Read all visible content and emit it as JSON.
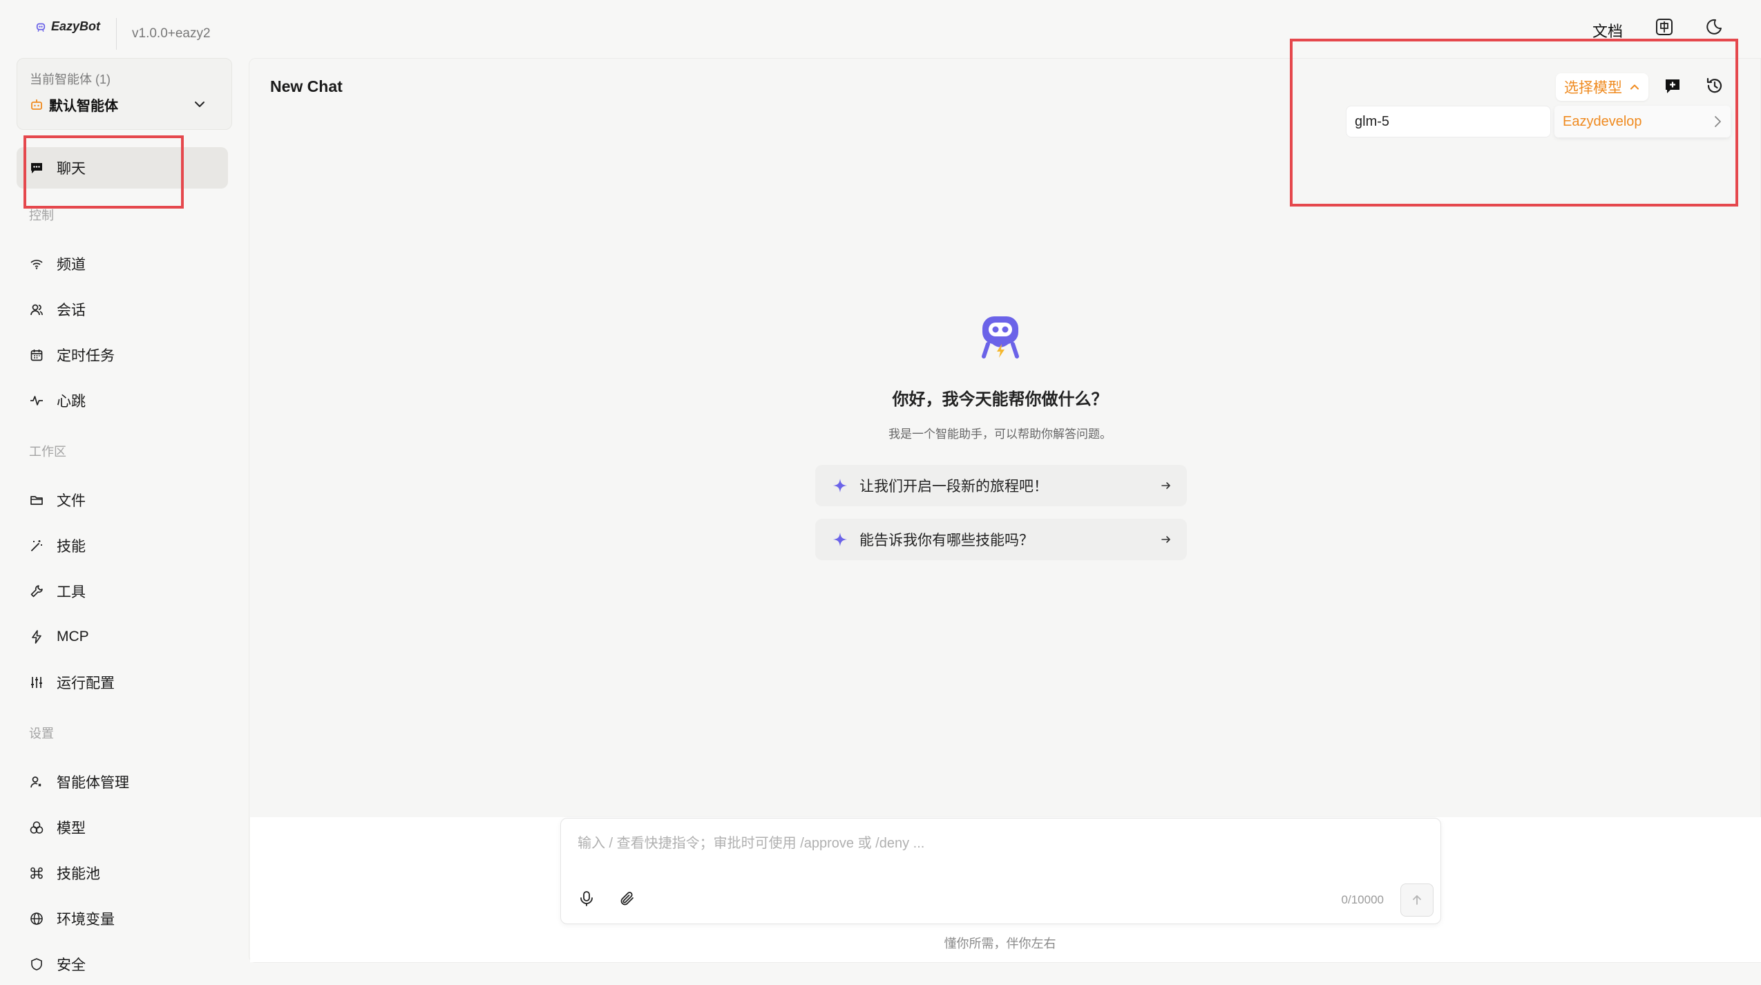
{
  "app": {
    "name": "EazyBot",
    "version": "v1.0.0+eazy2"
  },
  "topbar": {
    "docs_label": "文档",
    "lang_icon": "language-icon",
    "theme_icon": "moon-icon"
  },
  "agent_selector": {
    "caption": "当前智能体 (1)",
    "name": "默认智能体",
    "icon": "bot-icon"
  },
  "sidebar": {
    "chat_label": "聊天",
    "sections": {
      "control": "控制",
      "workspace": "工作区",
      "settings": "设置"
    },
    "control_items": [
      {
        "label": "频道",
        "icon": "wifi-icon"
      },
      {
        "label": "会话",
        "icon": "users-icon"
      },
      {
        "label": "定时任务",
        "icon": "calendar-icon"
      },
      {
        "label": "心跳",
        "icon": "pulse-icon"
      }
    ],
    "workspace_items": [
      {
        "label": "文件",
        "icon": "folder-icon"
      },
      {
        "label": "技能",
        "icon": "magic-wand-icon"
      },
      {
        "label": "工具",
        "icon": "wrench-icon"
      },
      {
        "label": "MCP",
        "icon": "lightning-icon"
      },
      {
        "label": "运行配置",
        "icon": "sliders-icon"
      }
    ],
    "settings_items": [
      {
        "label": "智能体管理",
        "icon": "user-cog-icon"
      },
      {
        "label": "模型",
        "icon": "model-icon"
      },
      {
        "label": "技能池",
        "icon": "command-icon"
      },
      {
        "label": "环境变量",
        "icon": "globe-icon"
      },
      {
        "label": "安全",
        "icon": "shield-icon"
      }
    ]
  },
  "chat": {
    "title": "New Chat",
    "model_select_label": "选择模型",
    "model_search_value": "glm-5",
    "provider_option": "Eazydevelop",
    "welcome_title": "你好，我今天能帮你做什么？",
    "welcome_subtitle": "我是一个智能助手，可以帮助你解答问题。",
    "suggestions": [
      "让我们开启一段新的旅程吧！",
      "能告诉我你有哪些技能吗？"
    ],
    "composer_placeholder": "输入 / 查看快捷指令；审批时可使用 /approve 或 /deny ...",
    "char_count": "0/10000",
    "tagline": "懂你所需，伴你左右"
  },
  "colors": {
    "accent": "#ef8a1f",
    "annotation": "#e5484d",
    "robot": "#6b63e8"
  }
}
